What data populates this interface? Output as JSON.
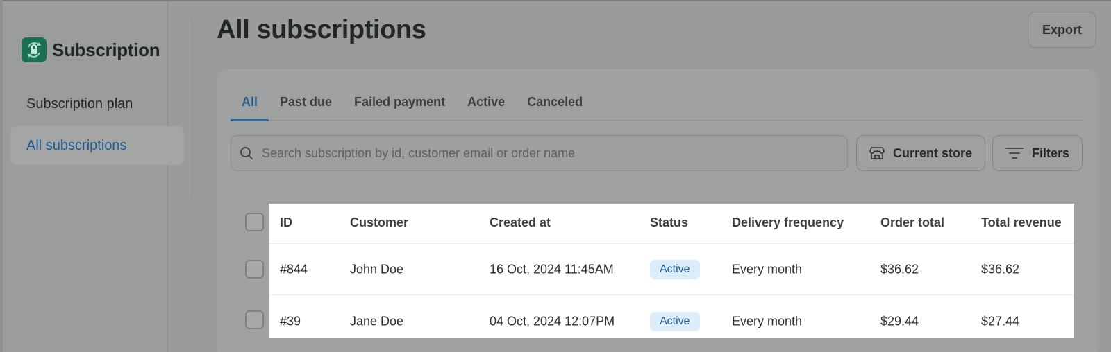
{
  "app": {
    "name": "Subscription",
    "logo_icon": "lock-cycle-icon",
    "brand_color": "#1c6f56",
    "accent_color": "#2b66a0"
  },
  "sidebar": {
    "items": [
      {
        "label": "Subscription plan",
        "active": false
      },
      {
        "label": "All subscriptions",
        "active": true
      }
    ]
  },
  "header": {
    "title": "All subscriptions",
    "export_label": "Export"
  },
  "tabs": [
    {
      "label": "All",
      "active": true
    },
    {
      "label": "Past due",
      "active": false
    },
    {
      "label": "Failed payment",
      "active": false
    },
    {
      "label": "Active",
      "active": false
    },
    {
      "label": "Canceled",
      "active": false
    }
  ],
  "search": {
    "placeholder": "Search subscription by id, customer email or order name",
    "value": "",
    "icon": "search-icon"
  },
  "toolbar": {
    "store_label": "Current store",
    "store_icon": "store-icon",
    "filters_label": "Filters",
    "filters_icon": "filter-lines-icon"
  },
  "table": {
    "columns": [
      "ID",
      "Customer",
      "Created at",
      "Status",
      "Delivery frequency",
      "Order total",
      "Total revenue"
    ],
    "rows": [
      {
        "id": "#844",
        "customer": "John Doe",
        "created_at": "16 Oct, 2024 11:45AM",
        "status": "Active",
        "frequency": "Every month",
        "order_total": "$36.62",
        "total_revenue": "$36.62"
      },
      {
        "id": "#39",
        "customer": "Jane Doe",
        "created_at": "04 Oct, 2024 12:07PM",
        "status": "Active",
        "frequency": "Every month",
        "order_total": "$29.44",
        "total_revenue": "$27.44"
      }
    ],
    "status_badge_bg": "#dcecfb",
    "status_badge_text": "#1f5b92"
  }
}
